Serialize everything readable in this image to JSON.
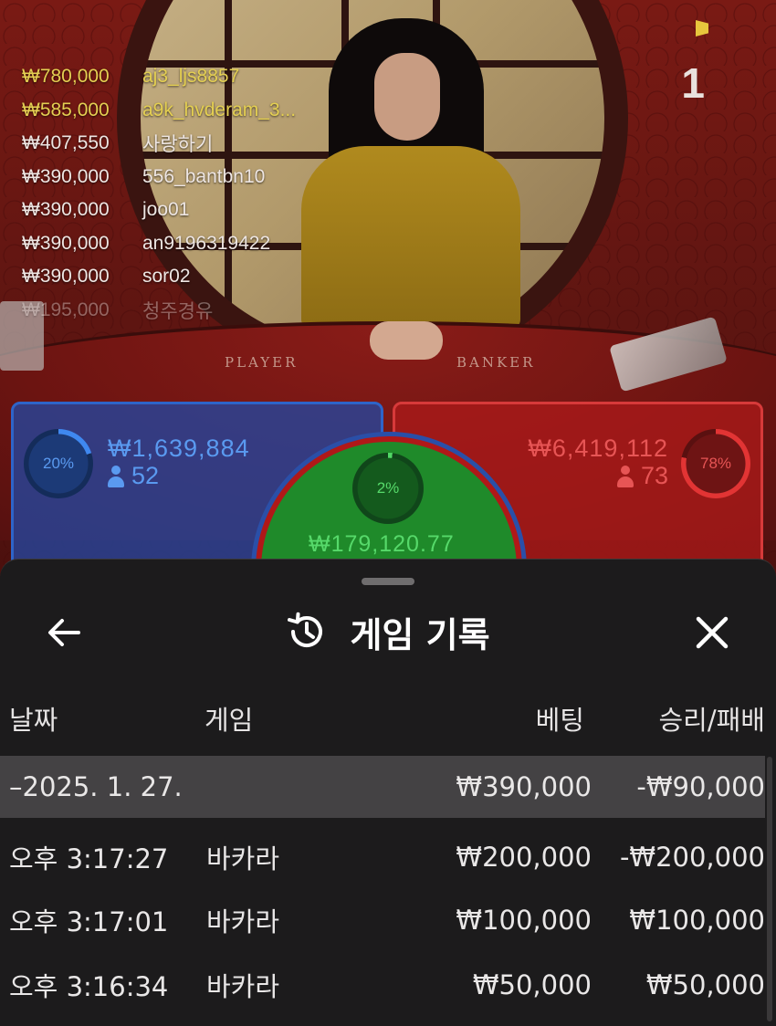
{
  "video": {
    "round_number": "1",
    "table_labels": {
      "player": "PLAYER",
      "banker": "BANKER"
    }
  },
  "winners": [
    {
      "amount": "₩780,000",
      "user": "aj3_ljs8857"
    },
    {
      "amount": "₩585,000",
      "user": "a9k_hvderam_3..."
    },
    {
      "amount": "₩407,550",
      "user": "사랑하기"
    },
    {
      "amount": "₩390,000",
      "user": "556_bantbn10"
    },
    {
      "amount": "₩390,000",
      "user": "joo01"
    },
    {
      "amount": "₩390,000",
      "user": "an9196319422"
    },
    {
      "amount": "₩390,000",
      "user": "sor02"
    },
    {
      "amount": "₩195,000",
      "user": "청주경유"
    }
  ],
  "bets": {
    "player": {
      "percent": "20%",
      "percent_value": 0.2,
      "amount": "₩1,639,884",
      "count": "52",
      "color": "#3f88f0"
    },
    "banker": {
      "percent": "78%",
      "percent_value": 0.78,
      "amount": "₩6,419,112",
      "count": "73",
      "color": "#e23434"
    },
    "tie": {
      "percent": "2%",
      "percent_value": 0.02,
      "amount": "₩179,120.77",
      "color": "#52d866"
    }
  },
  "history": {
    "title": "게임 기록",
    "icons": {
      "back": "arrow-left-icon",
      "title": "history-icon",
      "close": "close-icon"
    },
    "columns": {
      "date": "날짜",
      "game": "게임",
      "bet": "베팅",
      "result": "승리/패배"
    },
    "date_group": {
      "label": "–2025. 1. 27.",
      "bet": "₩390,000",
      "result": "-₩90,000"
    },
    "rows": [
      {
        "time": "오후 3:17:27",
        "game": "바카라",
        "bet": "₩200,000",
        "result": "-₩200,000"
      },
      {
        "time": "오후 3:17:01",
        "game": "바카라",
        "bet": "₩100,000",
        "result": "₩100,000"
      },
      {
        "time": "오후 3:16:34",
        "game": "바카라",
        "bet": "₩50,000",
        "result": "₩50,000"
      }
    ]
  }
}
